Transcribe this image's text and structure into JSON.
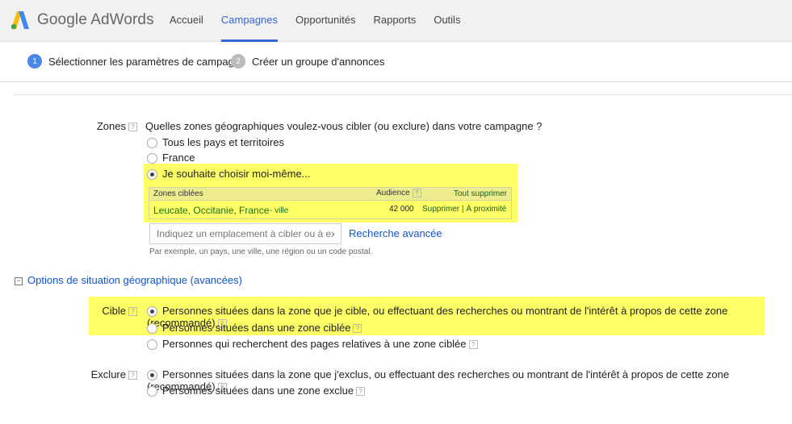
{
  "app": {
    "logo_text": "Google AdWords"
  },
  "nav": {
    "items": [
      {
        "label": "Accueil"
      },
      {
        "label": "Campagnes"
      },
      {
        "label": "Opportunités"
      },
      {
        "label": "Rapports"
      },
      {
        "label": "Outils"
      }
    ],
    "active": "Campagnes"
  },
  "steps": [
    {
      "num": "1",
      "label": "Sélectionner les paramètres de campagne"
    },
    {
      "num": "2",
      "label": "Créer un groupe d'annonces"
    }
  ],
  "zones": {
    "label": "Zones",
    "question": "Quelles zones géographiques voulez-vous cibler (ou exclure) dans votre campagne ?",
    "options": [
      {
        "label": "Tous les pays et territoires",
        "checked": false
      },
      {
        "label": "France",
        "checked": false
      },
      {
        "label": "Je souhaite choisir moi-même...",
        "checked": true
      }
    ],
    "table": {
      "header_zones": "Zones ciblées",
      "header_audience": "Audience",
      "header_action": "Tout supprimer",
      "row": {
        "name": "Leucate, Occitanie, France",
        "type": "- ville",
        "audience": "42 000",
        "remove": "Supprimer",
        "separator": "|",
        "nearby": "À proximité"
      }
    },
    "input_placeholder": "Indiquez un emplacement à cibler ou à exclure.",
    "advanced_search": "Recherche avancée",
    "hint": "Par exemple, un pays, une ville, une région ou un code postal."
  },
  "location_options": {
    "toggle_symbol": "−",
    "title": "Options de situation géographique (avancées)",
    "cible": {
      "label": "Cible",
      "options": [
        {
          "label": "Personnes situées dans la zone que je cible, ou effectuant des recherches ou montrant de l'intérêt à propos de cette zone (recommandé)",
          "checked": true
        },
        {
          "label": "Personnes situées dans une zone ciblée",
          "checked": false
        },
        {
          "label": "Personnes qui recherchent des pages relatives à une zone ciblée",
          "checked": false
        }
      ]
    },
    "exclure": {
      "label": "Exclure",
      "options": [
        {
          "label": "Personnes situées dans la zone que j'exclus, ou effectuant des recherches ou montrant de l'intérêt à propos de cette zone (recommandé)",
          "checked": true
        },
        {
          "label": "Personnes situées dans une zone exclue",
          "checked": false
        }
      ]
    }
  },
  "help_symbol": "?",
  "colors": {
    "accent": "#3367d6",
    "highlight": "#ffff66",
    "green_text": "#1b6f1b"
  }
}
